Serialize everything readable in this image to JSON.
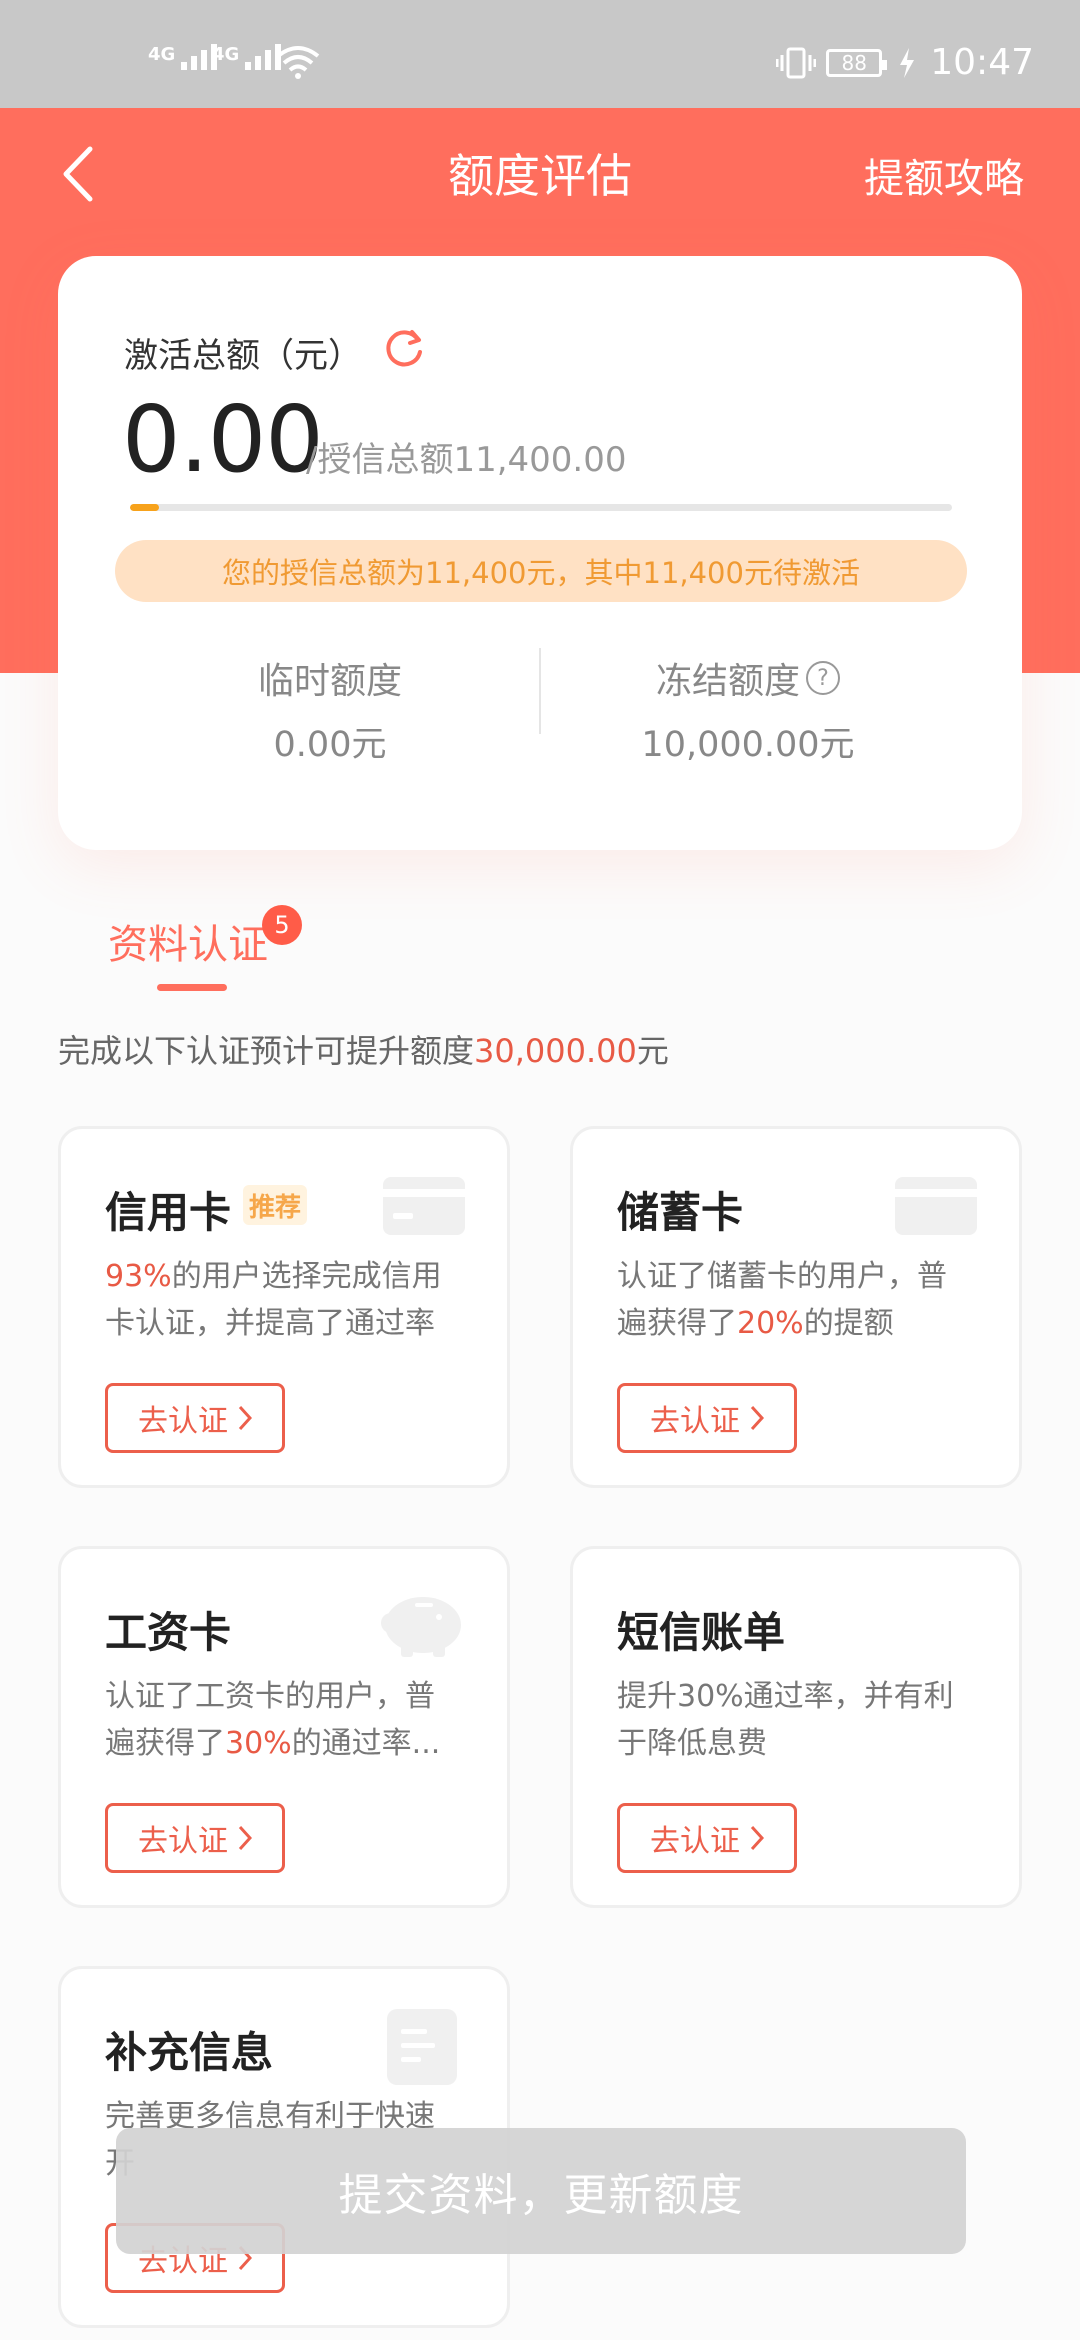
{
  "status_bar": {
    "signal1_label": "4G",
    "signal2_label": "4G",
    "battery": "88",
    "time": "10:47"
  },
  "header": {
    "title": "额度评估",
    "right_link": "提额攻略"
  },
  "summary": {
    "activated_label": "激活总额（元）",
    "activated_amount": "0.00",
    "credit_total_text": "/授信总额11,400.00",
    "progress_fraction": 0.035,
    "notice": "您的授信总额为11,400元，其中11,400元待激活",
    "temp_label": "临时额度",
    "temp_value": "0.00元",
    "frozen_label": "冻结额度",
    "frozen_value": "10,000.00元"
  },
  "section": {
    "tab_label": "资料认证",
    "badge_count": "5",
    "hint_prefix": "完成以下认证预计可提升额度",
    "hint_amount": "30,000.00",
    "hint_suffix": "元"
  },
  "cards": [
    {
      "title": "信用卡",
      "tag": "推荐",
      "desc_line1_hl": "93%",
      "desc_line1": "的用户选择完成信用",
      "desc_line2": "卡认证，并提高了通过率",
      "button": "去认证"
    },
    {
      "title": "储蓄卡",
      "desc_line1": "认证了储蓄卡的用户，普",
      "desc_line2_pre": "遍获得了",
      "desc_line2_hl": "20%",
      "desc_line2_post": "的提额",
      "button": "去认证"
    },
    {
      "title": "工资卡",
      "desc_line1": "认证了工资卡的用户，普",
      "desc_line2_pre": "遍获得了",
      "desc_line2_hl": "30%",
      "desc_line2_post": "的通过率...",
      "button": "去认证"
    },
    {
      "title": "短信账单",
      "desc_line1": "提升30%通过率，并有利",
      "desc_line2": "于降低息费",
      "button": "去认证"
    },
    {
      "title": "补充信息",
      "desc_line1": "完善更多信息有利于快速",
      "desc_line2": "开",
      "button": "去认证"
    }
  ],
  "submit_button": "提交资料，更新额度",
  "colors": {
    "brand": "#ff6e5d",
    "accent_orange": "#f7a21b",
    "highlight_red": "#e85a45"
  }
}
